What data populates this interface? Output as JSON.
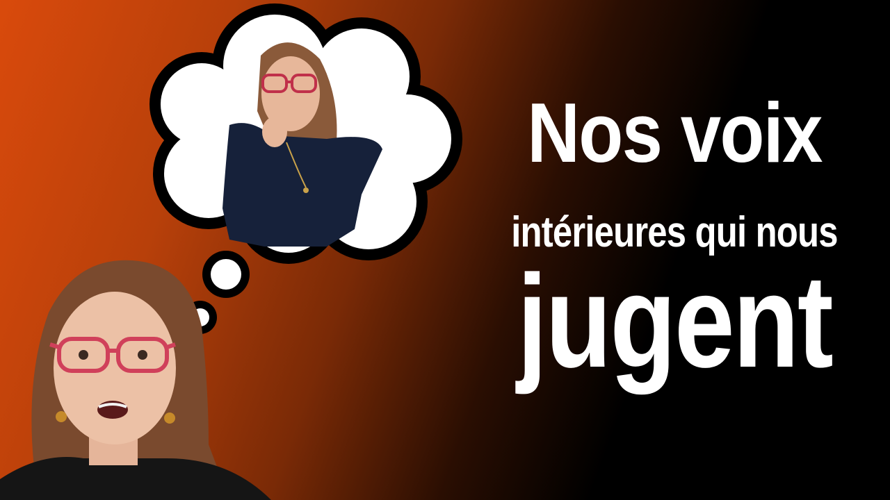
{
  "headline": {
    "line1": "Nos voix",
    "line2": "intérieures qui nous",
    "line3": "jugent"
  },
  "colors": {
    "gradient_start": "#d94a0c",
    "gradient_end": "#000000",
    "text": "#ffffff",
    "bubble_fill": "#ffffff",
    "bubble_outline": "#000000"
  },
  "figures": {
    "thought_figure": "woman-pointing-icon",
    "foreground_figure": "surprised-woman-icon"
  }
}
